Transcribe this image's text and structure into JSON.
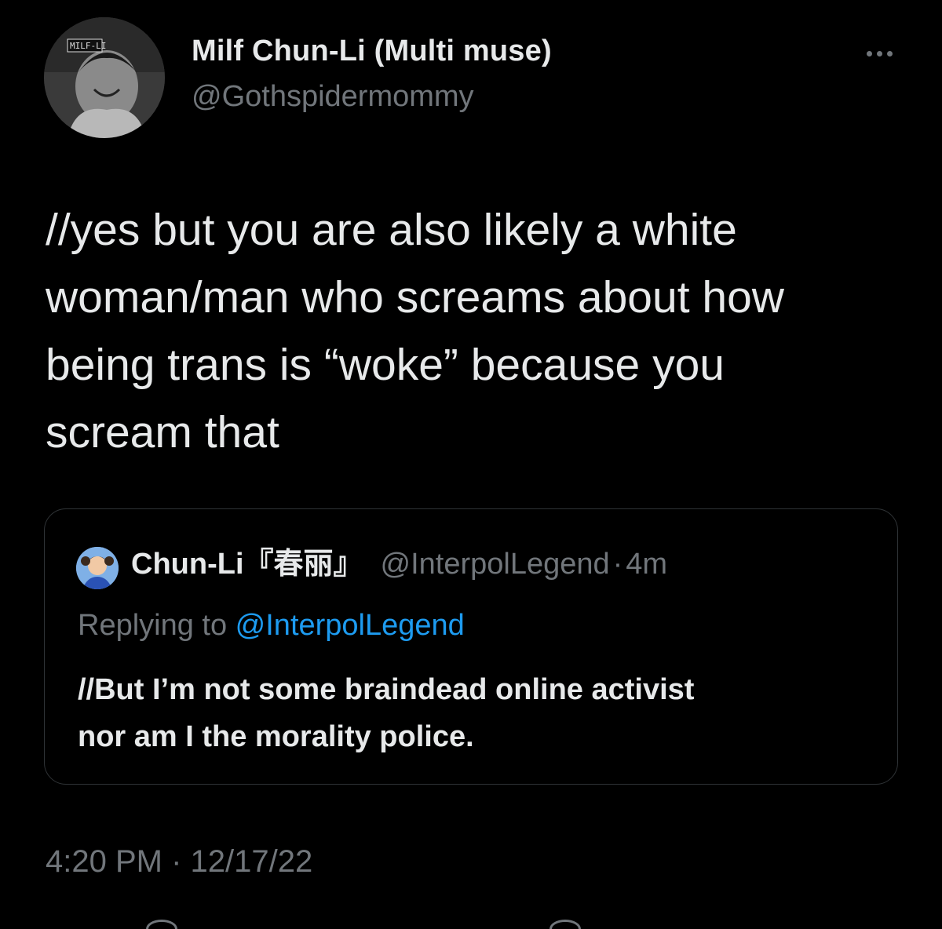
{
  "colors": {
    "background": "#000000",
    "primary_text": "#e7e9ea",
    "secondary_text": "#71767b",
    "link": "#1d9bf0",
    "border": "#2f3336"
  },
  "author": {
    "display_name": "Milf Chun-Li (Multi muse)",
    "handle": "@Gothspidermommy",
    "avatar_icon": "avatar-image"
  },
  "more_icon": "more-horizontal-icon",
  "tweet": {
    "text": "//yes but you are also likely a white\nwoman/man who screams about how\nbeing trans is “woke” because you\nscream that"
  },
  "quoted_tweet": {
    "display_name": "Chun-Li『春丽』",
    "handle": "@InterpolLegend",
    "separator": "·",
    "time": "4m",
    "replying_prefix": "Replying to ",
    "replying_to": "@InterpolLegend",
    "text": "//But I’m not some braindead online activist\nnor am I the morality police."
  },
  "timestamp": "4:20 PM · 12/17/22"
}
